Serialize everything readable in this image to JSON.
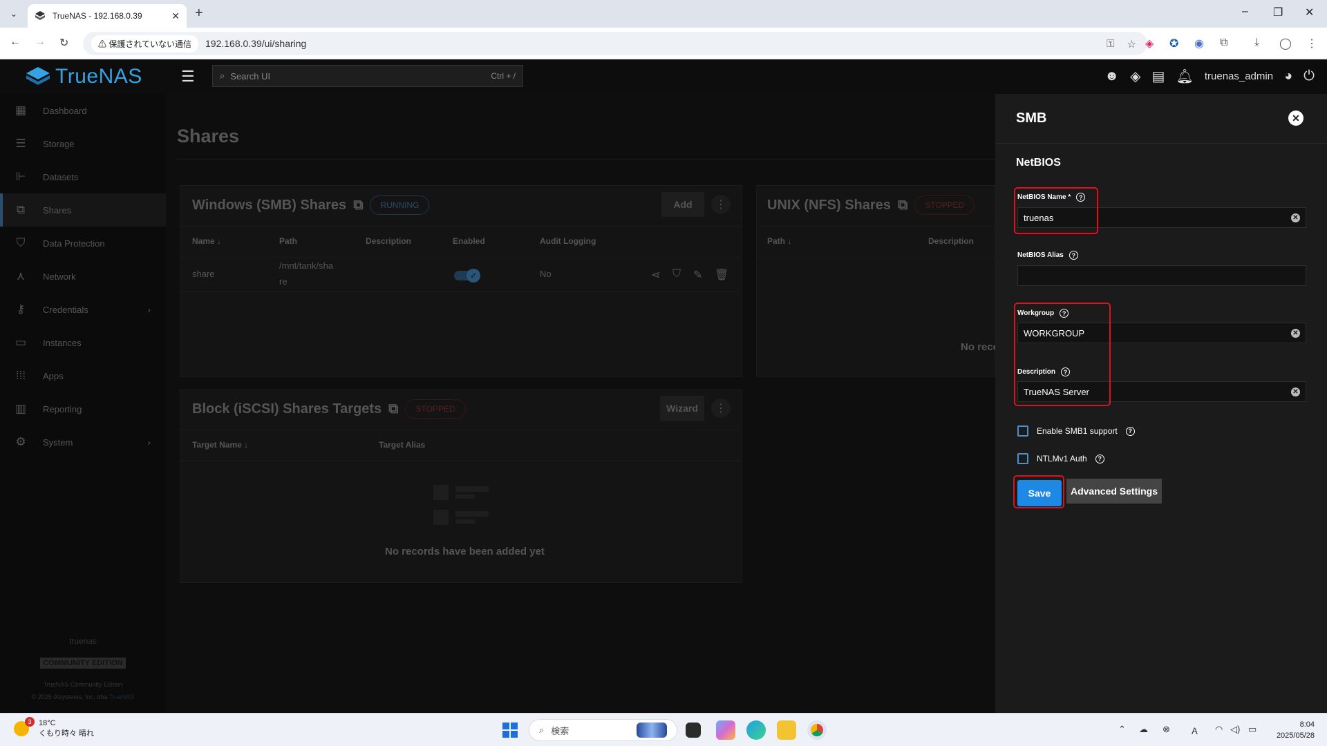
{
  "browser": {
    "tab_title": "TrueNAS - 192.168.0.39",
    "security_label": "保護されていない通信",
    "url": "192.168.0.39/ui/sharing"
  },
  "header": {
    "logo_text": "TrueNAS",
    "search_placeholder": "Search UI",
    "search_shortcut": "Ctrl + /",
    "username": "truenas_admin"
  },
  "sidebar": {
    "items": [
      {
        "label": "Dashboard",
        "icon": "dashboard-icon"
      },
      {
        "label": "Storage",
        "icon": "storage-icon"
      },
      {
        "label": "Datasets",
        "icon": "datasets-icon"
      },
      {
        "label": "Shares",
        "icon": "shares-icon"
      },
      {
        "label": "Data Protection",
        "icon": "shield-icon"
      },
      {
        "label": "Network",
        "icon": "network-icon"
      },
      {
        "label": "Credentials",
        "icon": "key-icon"
      },
      {
        "label": "Instances",
        "icon": "laptop-icon"
      },
      {
        "label": "Apps",
        "icon": "apps-icon"
      },
      {
        "label": "Reporting",
        "icon": "chart-icon"
      },
      {
        "label": "System",
        "icon": "gear-icon"
      }
    ],
    "hostname": "truenas",
    "edition_badge": "COMMUNITY EDITION",
    "footer_line1": "TrueNAS Community Edition",
    "footer_line2": "© 2025 iXsystems, Inc. dba",
    "footer_link": "TrueNAS"
  },
  "main": {
    "page_title": "Shares",
    "smb_card": {
      "title": "Windows (SMB) Shares",
      "status": "RUNNING",
      "add_label": "Add",
      "columns": [
        "Name",
        "Path",
        "Description",
        "Enabled",
        "Audit Logging"
      ],
      "row": {
        "name": "share",
        "path_line1": "/mnt/tank/sha",
        "path_line2": "re",
        "description": "",
        "audit": "No"
      }
    },
    "nfs_card": {
      "title": "UNIX (NFS) Shares",
      "status": "STOPPED",
      "columns": [
        "Path",
        "Description"
      ],
      "empty": "No reco"
    },
    "iscsi_card": {
      "title": "Block (iSCSI) Shares Targets",
      "status": "STOPPED",
      "wizard_label": "Wizard",
      "columns": [
        "Target Name",
        "Target Alias"
      ],
      "empty": "No records have been added yet"
    }
  },
  "panel": {
    "title": "SMB",
    "section": "NetBIOS",
    "netbios_name_label": "NetBIOS Name *",
    "netbios_name_value": "truenas",
    "netbios_alias_label": "NetBIOS Alias",
    "netbios_alias_value": "",
    "workgroup_label": "Workgroup",
    "workgroup_value": "WORKGROUP",
    "description_label": "Description",
    "description_value": "TrueNAS Server",
    "smb1_label": "Enable SMB1 support",
    "ntlm_label": "NTLMv1 Auth",
    "save_label": "Save",
    "advanced_label": "Advanced Settings"
  },
  "taskbar": {
    "weather_badge": "3",
    "temperature": "18°C",
    "weather_text": "くもり時々 晴れ",
    "search_text": "検索",
    "time": "8:04",
    "date": "2025/05/28"
  },
  "colors": {
    "accent": "#1e88e5",
    "logo": "#35a2e3",
    "highlight": "#e0101f"
  }
}
